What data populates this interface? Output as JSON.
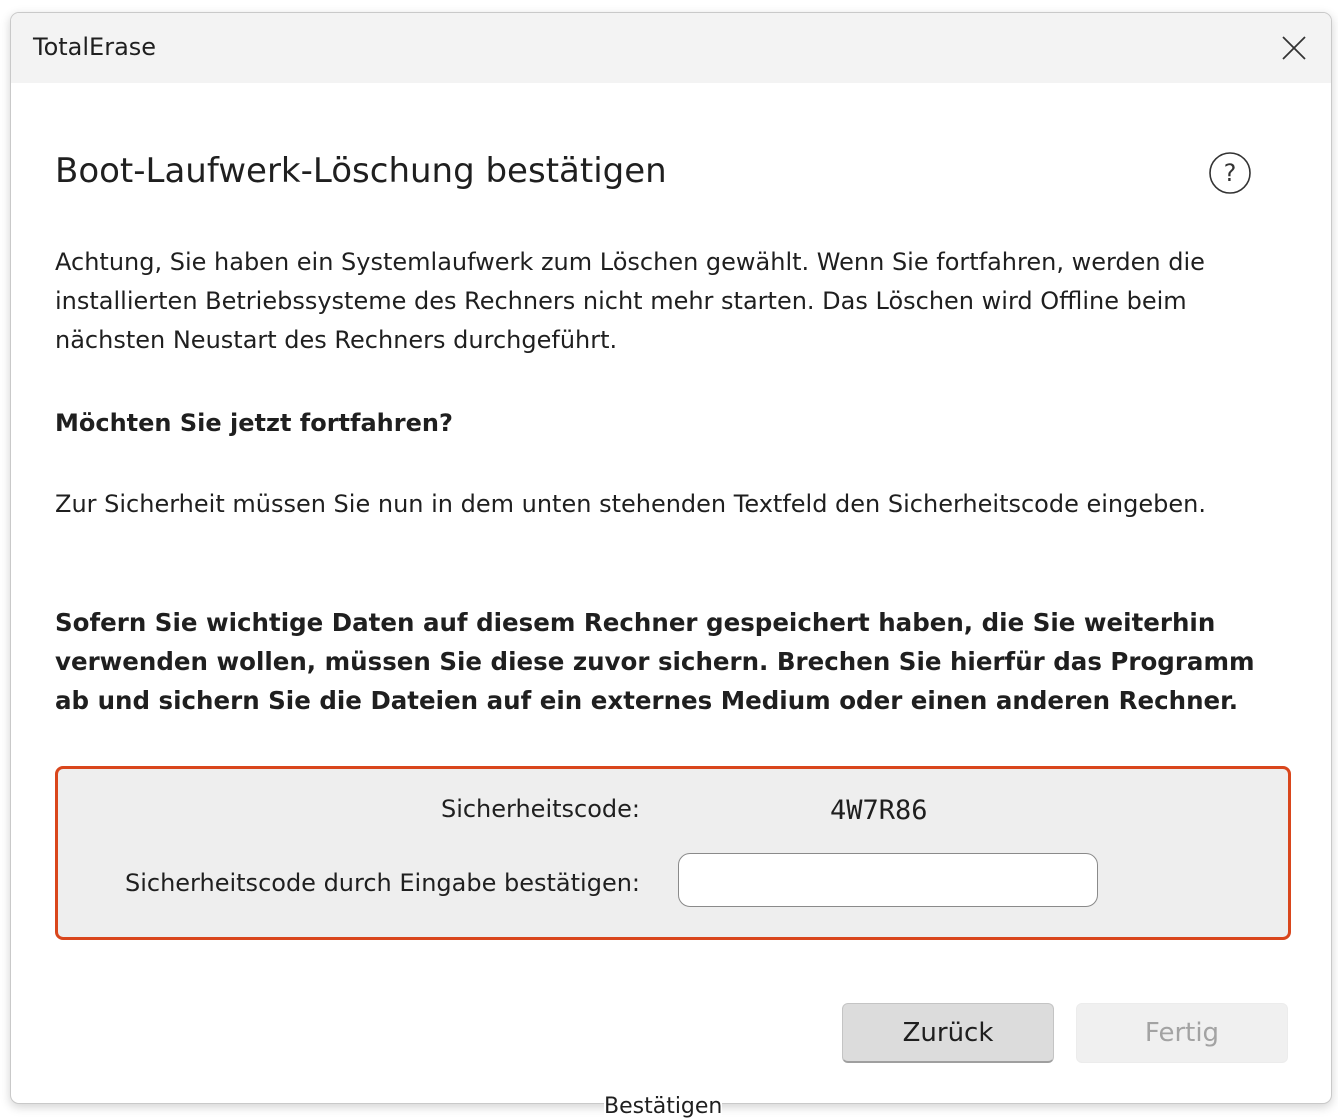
{
  "window": {
    "title": "TotalErase",
    "close_icon": "close-icon"
  },
  "dialog": {
    "heading": "Boot-Laufwerk-Löschung bestätigen",
    "help_icon": "question-circle-icon",
    "paragraph1": "Achtung, Sie haben ein Systemlaufwerk zum Löschen gewählt. Wenn Sie fortfahren, werden die installierten Betriebssysteme des Rechners nicht mehr starten. Das Löschen wird Offline beim nächsten Neustart des Rechners durchgeführt.",
    "question": "Möchten Sie jetzt fortfahren?",
    "paragraph2": "Zur Sicherheit müssen Sie nun in dem unten stehenden Textfeld den Sicherheitscode eingeben.",
    "warning": "Sofern Sie wichtige Daten auf diesem Rechner gespeichert haben, die Sie weiterhin verwenden wollen, müssen Sie diese zuvor sichern. Brechen Sie hierfür das Programm ab und sichern Sie die Dateien auf ein externes Medium oder einen anderen Rechner."
  },
  "security": {
    "code_label": "Sicherheitscode:",
    "code_value": "4W7R86",
    "confirm_label": "Sicherheitscode durch Eingabe bestätigen:",
    "confirm_value": "",
    "border_color": "#d9461c"
  },
  "buttons": {
    "back_label": "Zurück",
    "finish_label": "Fertig"
  },
  "tooltip": {
    "text": "Bestätigen"
  }
}
